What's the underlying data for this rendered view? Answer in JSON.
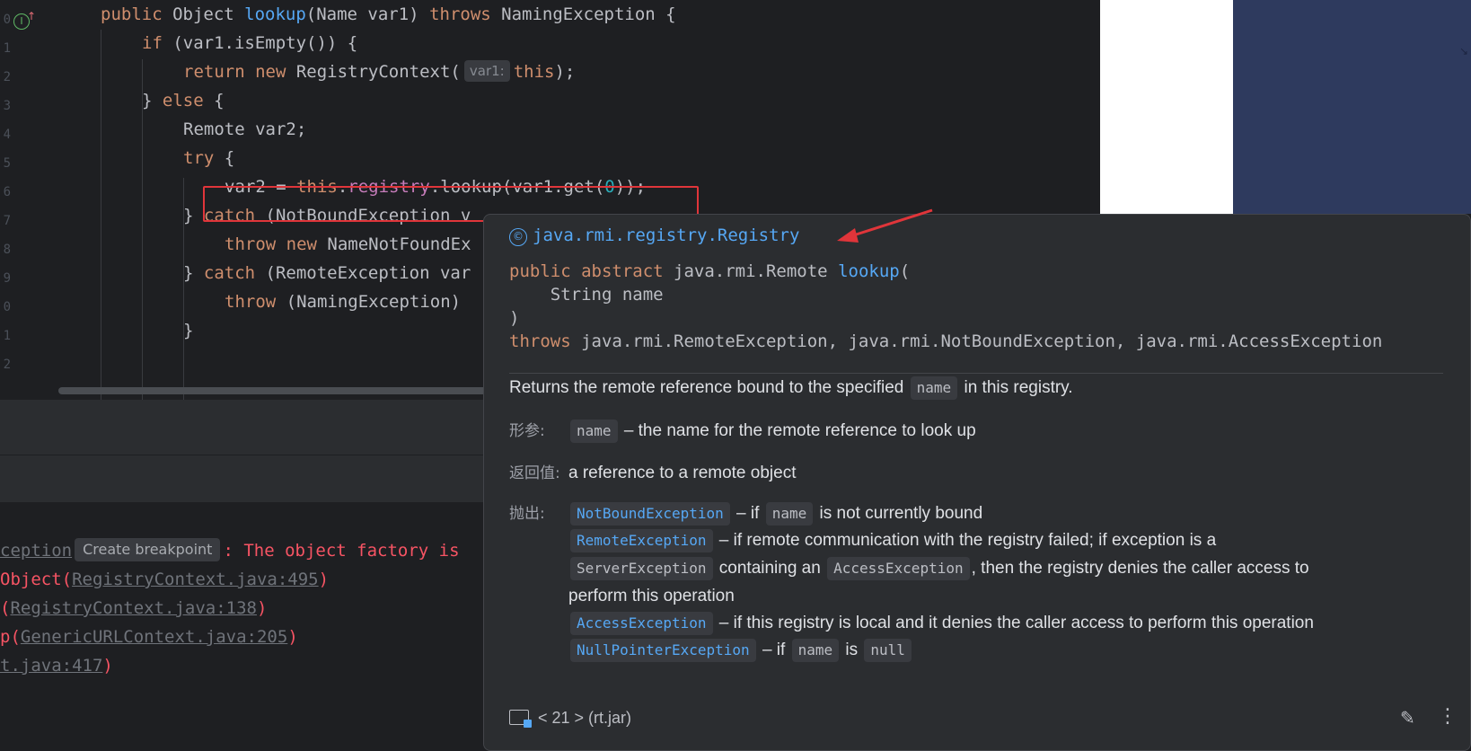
{
  "editor": {
    "line_numbers": [
      "0",
      "1",
      "2",
      "3",
      "4",
      "5",
      "6",
      "7",
      "8",
      "9",
      "0",
      "1",
      "2"
    ],
    "gutter_icon": "I",
    "lines": [
      [
        [
          "kw",
          "public "
        ],
        [
          "plain",
          "Object "
        ],
        [
          "fn",
          "lookup"
        ],
        [
          "plain",
          "(Name var1) "
        ],
        [
          "kw",
          "throws "
        ],
        [
          "plain",
          "NamingException {"
        ]
      ],
      [
        [
          "kw",
          "if "
        ],
        [
          "plain",
          "(var1.isEmpty()) {"
        ]
      ],
      [
        [
          "kw",
          "return new "
        ],
        [
          "plain",
          "RegistryContext("
        ],
        [
          "hint",
          "var1:"
        ],
        [
          "kw",
          "this"
        ],
        [
          "plain",
          ");"
        ]
      ],
      [
        [
          "plain",
          "} "
        ],
        [
          "kw",
          "else "
        ],
        [
          "plain",
          "{"
        ]
      ],
      [
        [
          "plain",
          "Remote var2;"
        ]
      ],
      [
        [
          "kw",
          "try "
        ],
        [
          "plain",
          "{"
        ]
      ],
      [
        [
          "plain",
          "var2 = "
        ],
        [
          "kw",
          "this"
        ],
        [
          "plain",
          "."
        ],
        [
          "fld",
          "registry"
        ],
        [
          "plain",
          ".lookup(var1.get("
        ],
        [
          "num",
          "0"
        ],
        [
          "plain",
          "));"
        ]
      ],
      [
        [
          "plain",
          "} "
        ],
        [
          "kw",
          "catch "
        ],
        [
          "plain",
          "(NotBoundException v"
        ]
      ],
      [
        [
          "kw",
          "throw new "
        ],
        [
          "plain",
          "NameNotFoundEx"
        ]
      ],
      [
        [
          "plain",
          "} "
        ],
        [
          "kw",
          "catch "
        ],
        [
          "plain",
          "(RemoteException var"
        ]
      ],
      [
        [
          "kw",
          "throw "
        ],
        [
          "plain",
          "(NamingException)"
        ]
      ],
      [
        [
          "plain",
          "}"
        ]
      ]
    ]
  },
  "console": {
    "line1_link": "ception",
    "breakpoint_label": "Create breakpoint",
    "line1_msg": ": The object factory is",
    "line2_pre": "Object(",
    "line2_link": "RegistryContext.java:495",
    "line2_post": ")",
    "line3_pre": "(",
    "line3_link": "RegistryContext.java:138",
    "line3_post": ")",
    "line4_pre": "p(",
    "line4_link": "GenericURLContext.java:205",
    "line4_post": ")",
    "line5_link": "t.java:417",
    "line5_post": ")"
  },
  "doc": {
    "class_name": "java.rmi.registry.Registry",
    "sig_kw": "public abstract ",
    "sig_ret": "java.rmi.Remote ",
    "sig_method": "lookup",
    "sig_open": "(",
    "sig_param": "    String name",
    "sig_close": ")",
    "throws_kw": "throws ",
    "throws_list": "java.rmi.RemoteException, java.rmi.NotBoundException, java.rmi.AccessException",
    "desc_pre": "Returns the remote reference bound to the specified",
    "desc_code": "name",
    "desc_post": "in this registry.",
    "param_label": "形参:",
    "param_code": "name",
    "param_text": "– the name for the remote reference to look up",
    "return_label": "返回值:",
    "return_text": "a reference to a remote object",
    "throws_label": "抛出:",
    "t1_ex": "NotBoundException",
    "t1_pre": "– if",
    "t1_code": "name",
    "t1_post": "is not currently bound",
    "t2_ex": "RemoteException",
    "t2_text": "– if remote communication with the registry failed; if exception is a",
    "t2b_ex": "ServerException",
    "t2b_mid": "containing an",
    "t2b_ex2": "AccessException",
    "t2b_post": ", then the registry denies the caller access to",
    "t2c_text": "perform this operation",
    "t3_ex": "AccessException",
    "t3_text": "– if this registry is local and it denies the caller access to perform this operation",
    "t4_ex": "NullPointerException",
    "t4_pre": "– if",
    "t4_code": "name",
    "t4_mid": "is",
    "t4_code2": "null",
    "footer": "< 21 > (rt.jar)",
    "edit_icon": "✎",
    "more_icon": "⋮"
  },
  "icons": {
    "class_icon": "©"
  }
}
